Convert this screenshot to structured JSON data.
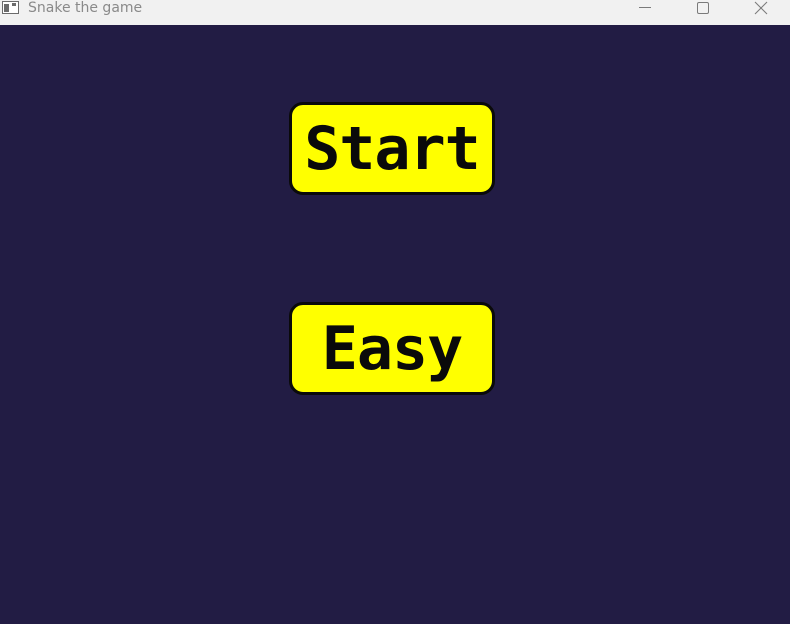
{
  "window": {
    "title": "Snake the game",
    "controls": {
      "minimize_icon": "minimize-icon",
      "maximize_icon": "maximize-icon",
      "close_icon": "close-icon"
    }
  },
  "menu": {
    "start_label": "Start",
    "difficulty_label": "Easy"
  },
  "colors": {
    "background": "#221c44",
    "button_fill": "#ffff00",
    "button_border": "#0a0a0a",
    "titlebar": "#f1f1f1"
  }
}
